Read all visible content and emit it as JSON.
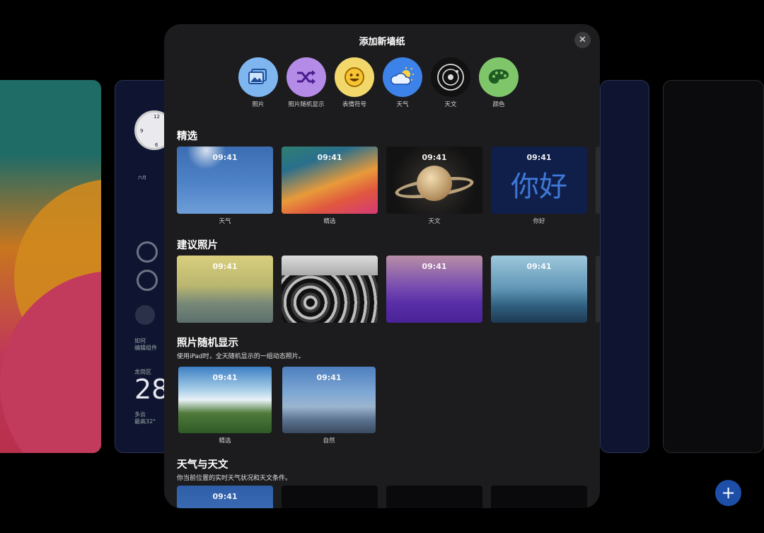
{
  "background": {
    "calendar": "六月",
    "widget_text_1": "如何",
    "widget_text_2": "编辑组件",
    "weather_location": "龙岗区",
    "weather_temp": "28",
    "weather_cond": "多云",
    "weather_hi": "最高32°",
    "add_label": "+"
  },
  "sheet": {
    "title": "添加新墙纸",
    "close": "✕"
  },
  "types": [
    {
      "label": "照片",
      "icon": "photos-icon",
      "color": "#7fb6f0"
    },
    {
      "label": "照片随机显示",
      "icon": "shuffle-icon",
      "color": "#b58be8"
    },
    {
      "label": "表情符号",
      "icon": "emoji-icon",
      "color": "#f2d86a"
    },
    {
      "label": "天气",
      "icon": "weather-icon",
      "color": "#3d82e8"
    },
    {
      "label": "天文",
      "icon": "astronomy-icon",
      "color": "#111111"
    },
    {
      "label": "颜色",
      "icon": "palette-icon",
      "color": "#7fc66a"
    }
  ],
  "featured": {
    "title": "精选",
    "items": [
      {
        "label": "天气",
        "time": "09:41"
      },
      {
        "label": "精选",
        "time": "09:41"
      },
      {
        "label": "天文",
        "time": "09:41"
      },
      {
        "label": "你好",
        "time": "09:41",
        "art": "你好"
      }
    ]
  },
  "suggested": {
    "title": "建议照片",
    "items": [
      {
        "time": "09:41"
      },
      {
        "time": "09:41"
      },
      {
        "time": "09:41"
      },
      {
        "time": "09:41"
      }
    ]
  },
  "shuffle": {
    "title": "照片随机显示",
    "subtitle": "使用iPad时，全天随机显示的一组动态照片。",
    "items": [
      {
        "label": "精选",
        "time": "09:41"
      },
      {
        "label": "自然",
        "time": "09:41"
      }
    ]
  },
  "weather_astro": {
    "title": "天气与天文",
    "subtitle": "你当前位置的实时天气状况和天文条件。",
    "items": [
      {
        "time": "09:41"
      }
    ]
  }
}
